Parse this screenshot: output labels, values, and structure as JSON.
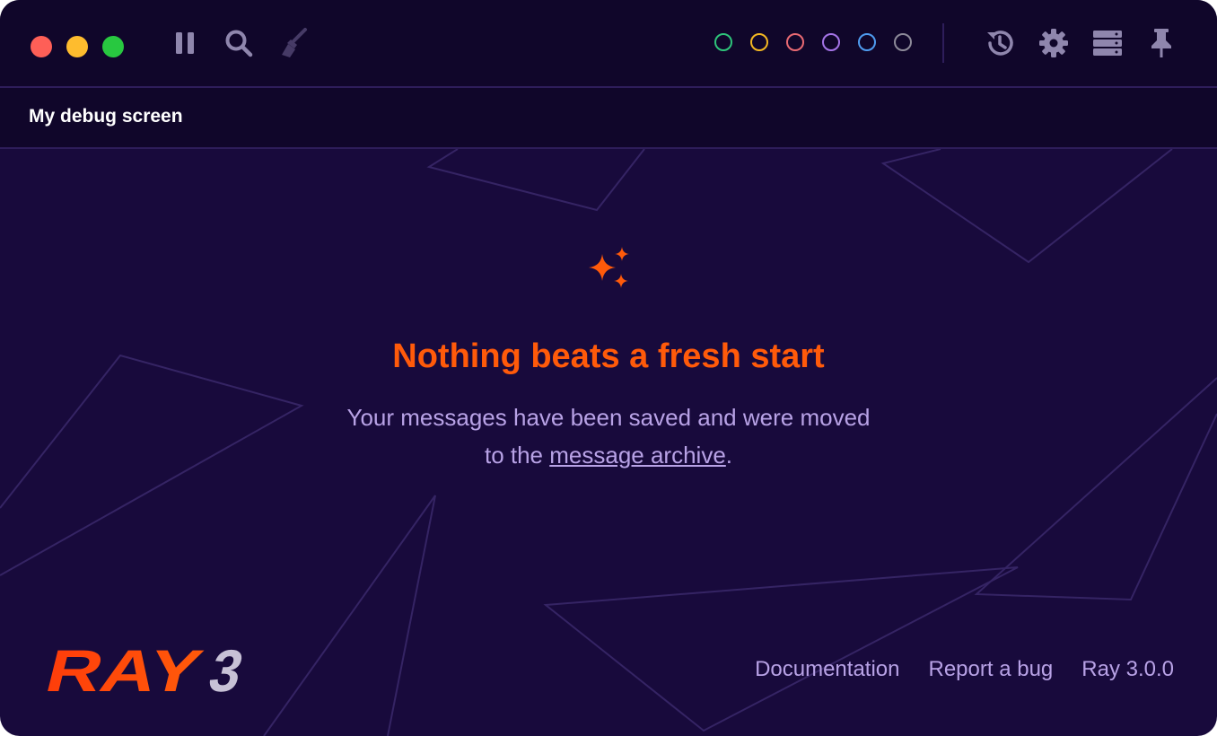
{
  "titlebar": {
    "traffic_lights": [
      "close",
      "minimize",
      "zoom"
    ],
    "tools_left": [
      {
        "name": "pause-icon"
      },
      {
        "name": "search-icon"
      },
      {
        "name": "clear-broom-icon"
      }
    ],
    "color_filters": [
      {
        "name": "green",
        "color": "#2ec47a"
      },
      {
        "name": "yellow",
        "color": "#f3b722"
      },
      {
        "name": "red",
        "color": "#ea6a73"
      },
      {
        "name": "purple",
        "color": "#a574e8"
      },
      {
        "name": "blue",
        "color": "#4f9cf0"
      },
      {
        "name": "gray",
        "color": "#8d8a99"
      }
    ],
    "tools_right": [
      {
        "name": "history-icon"
      },
      {
        "name": "settings-gear-icon"
      },
      {
        "name": "servers-icon"
      },
      {
        "name": "pin-icon"
      }
    ]
  },
  "screen": {
    "name": "My debug screen"
  },
  "empty_state": {
    "icon": "sparkles-icon",
    "title": "Nothing beats a fresh start",
    "line1": "Your messages have been saved and were moved",
    "line2_prefix": "to the ",
    "link": "message archive",
    "line2_suffix": "."
  },
  "footer": {
    "logo_text": "RAY",
    "logo_number": "3",
    "links": [
      "Documentation",
      "Report a bug",
      "Ray 3.0.0"
    ]
  },
  "colors": {
    "accent": "#ff5a0a",
    "background": "#180a3c",
    "titlebar": "#10062a",
    "muted_text": "#b8a2e6",
    "icon": "#8f86ad"
  }
}
